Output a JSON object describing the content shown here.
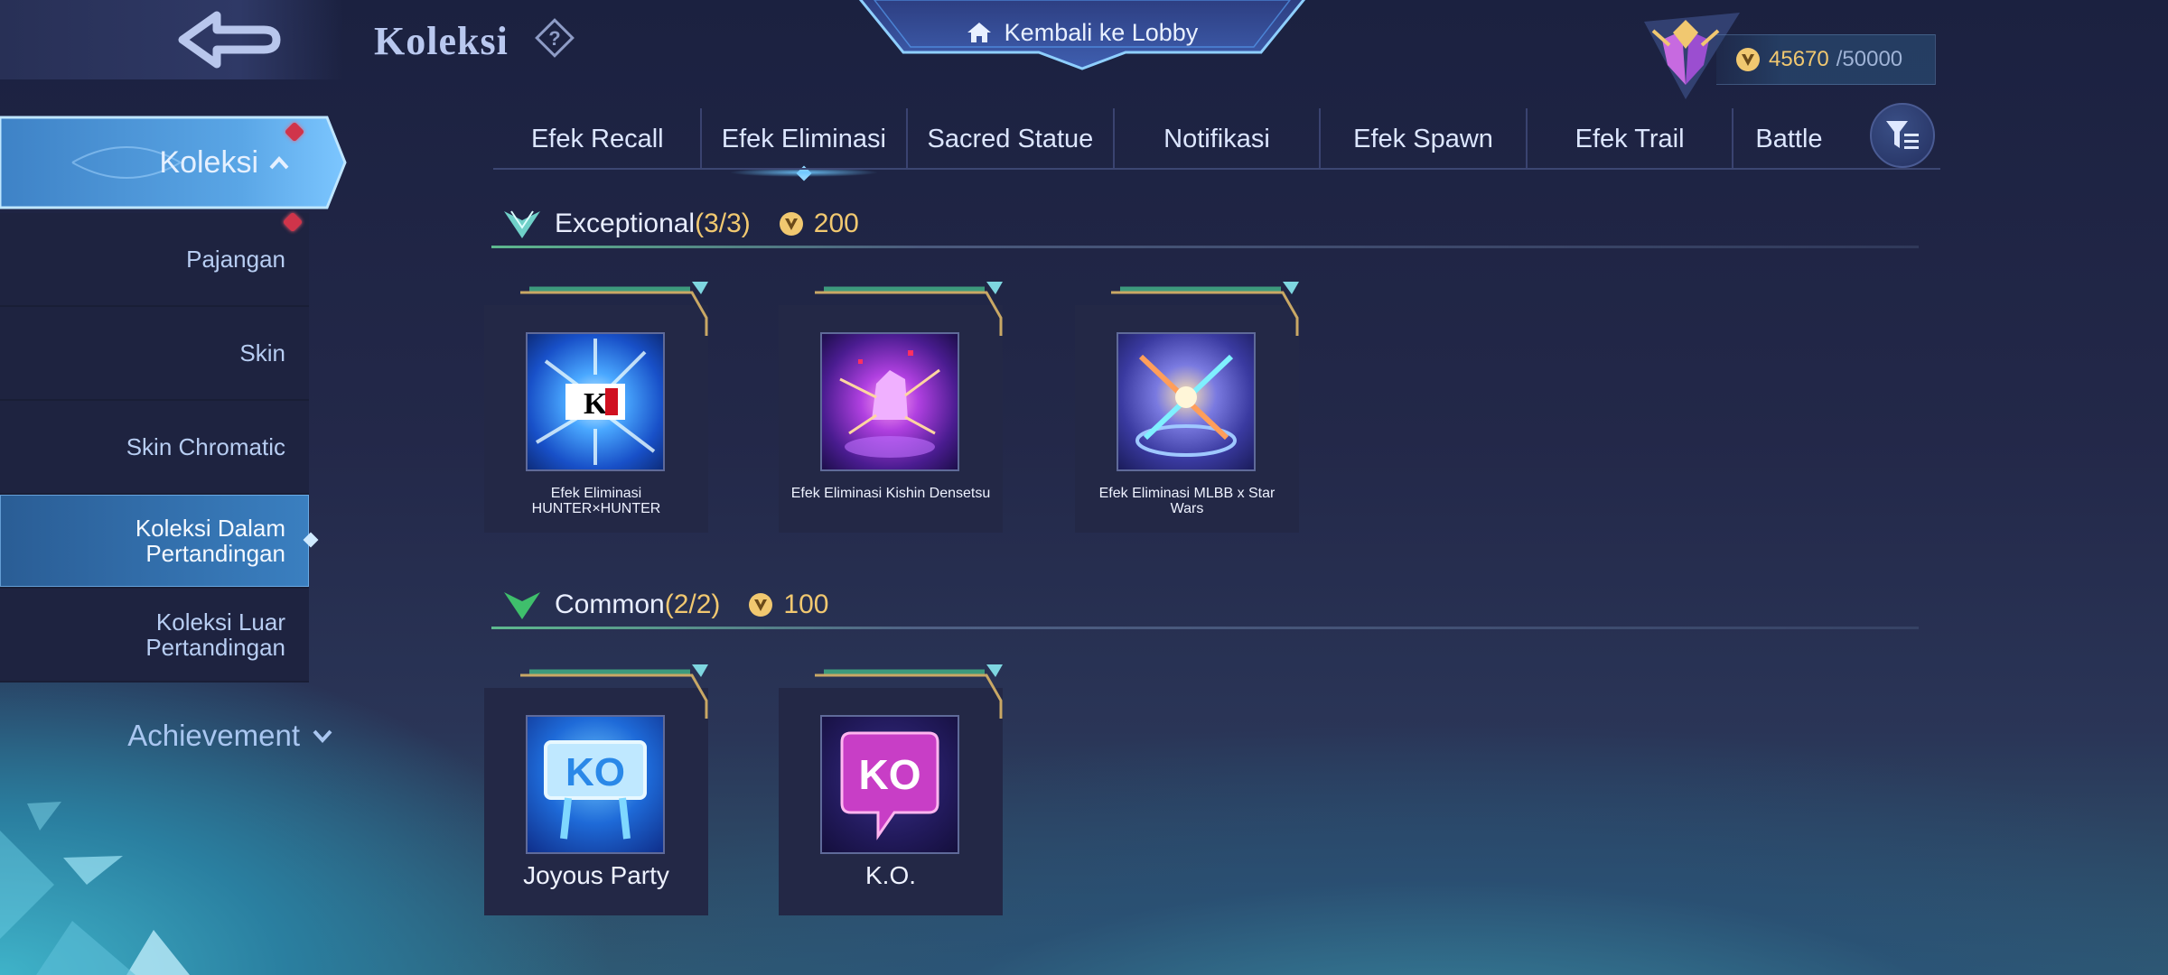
{
  "header": {
    "title": "Koleksi",
    "lobby_label": "Kembali ke Lobby",
    "currency_value": "45670",
    "currency_max": "/50000"
  },
  "sidebar": {
    "active_label": "Koleksi",
    "items": [
      {
        "label": "Pajangan",
        "badge": true
      },
      {
        "label": "Skin"
      },
      {
        "label": "Skin Chromatic"
      },
      {
        "label": "Koleksi Dalam\nPertandingan",
        "active": true
      },
      {
        "label": "Koleksi Luar\nPertandingan"
      }
    ],
    "achievement_label": "Achievement"
  },
  "tabs": [
    {
      "label": "Efek Recall"
    },
    {
      "label": "Efek Eliminasi",
      "active": true
    },
    {
      "label": "Sacred Statue"
    },
    {
      "label": "Notifikasi"
    },
    {
      "label": "Efek Spawn"
    },
    {
      "label": "Efek Trail"
    },
    {
      "label": "Battle"
    }
  ],
  "sections": [
    {
      "title": "Exceptional",
      "count": "(3/3)",
      "cost": "200",
      "items": [
        {
          "name": "Efek Eliminasi HUNTER×HUNTER",
          "icon": "ko-shatter-icon"
        },
        {
          "name": "Efek Eliminasi Kishin Densetsu",
          "icon": "purple-fist-icon"
        },
        {
          "name": "Efek Eliminasi MLBB x Star Wars",
          "icon": "crossed-sabers-icon"
        }
      ]
    },
    {
      "title": "Common",
      "count": "(2/2)",
      "cost": "100",
      "items": [
        {
          "name": "Joyous Party",
          "icon": "ko-sign-icon"
        },
        {
          "name": "K.O.",
          "icon": "ko-bubble-icon"
        }
      ]
    }
  ],
  "colors": {
    "accent_gold": "#f1c870",
    "tab_text": "#dce6ff",
    "active_blue": "#3a7fc0",
    "badge_red": "#d0344a"
  }
}
